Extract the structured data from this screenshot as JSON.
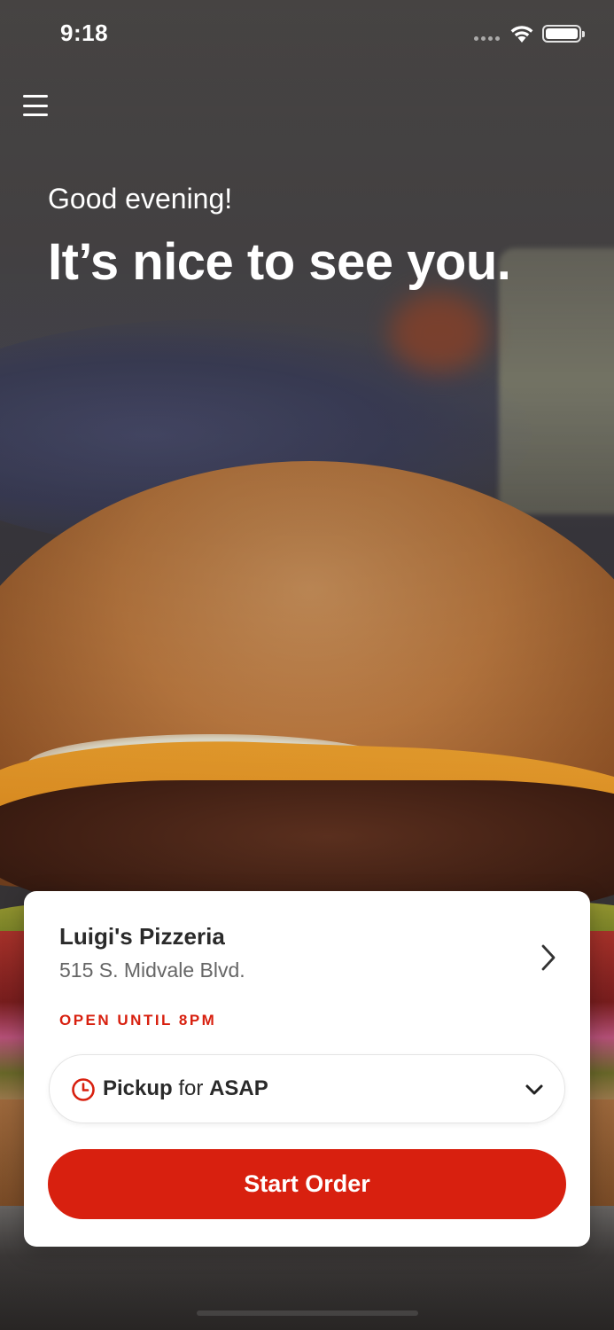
{
  "status_bar": {
    "time": "9:18",
    "wifi_icon": "wifi-icon",
    "battery_icon": "battery-icon"
  },
  "menu": {
    "icon": "hamburger-menu-icon"
  },
  "greeting": {
    "subtitle": "Good evening!",
    "title": "It’s nice to see you."
  },
  "store": {
    "name": "Luigi's Pizzeria",
    "address": "515 S. Midvale Blvd.",
    "hours": "OPEN UNTIL 8PM",
    "chevron_icon": "chevron-right-icon"
  },
  "order_mode": {
    "icon": "clock-icon",
    "mode": "Pickup",
    "connector": "for",
    "time": "ASAP",
    "dropdown_icon": "chevron-down-icon"
  },
  "actions": {
    "start_order_label": "Start Order"
  },
  "colors": {
    "accent": "#d8200f",
    "card_bg": "#ffffff",
    "text_dark": "#2a2a2a",
    "text_muted": "#666666"
  }
}
